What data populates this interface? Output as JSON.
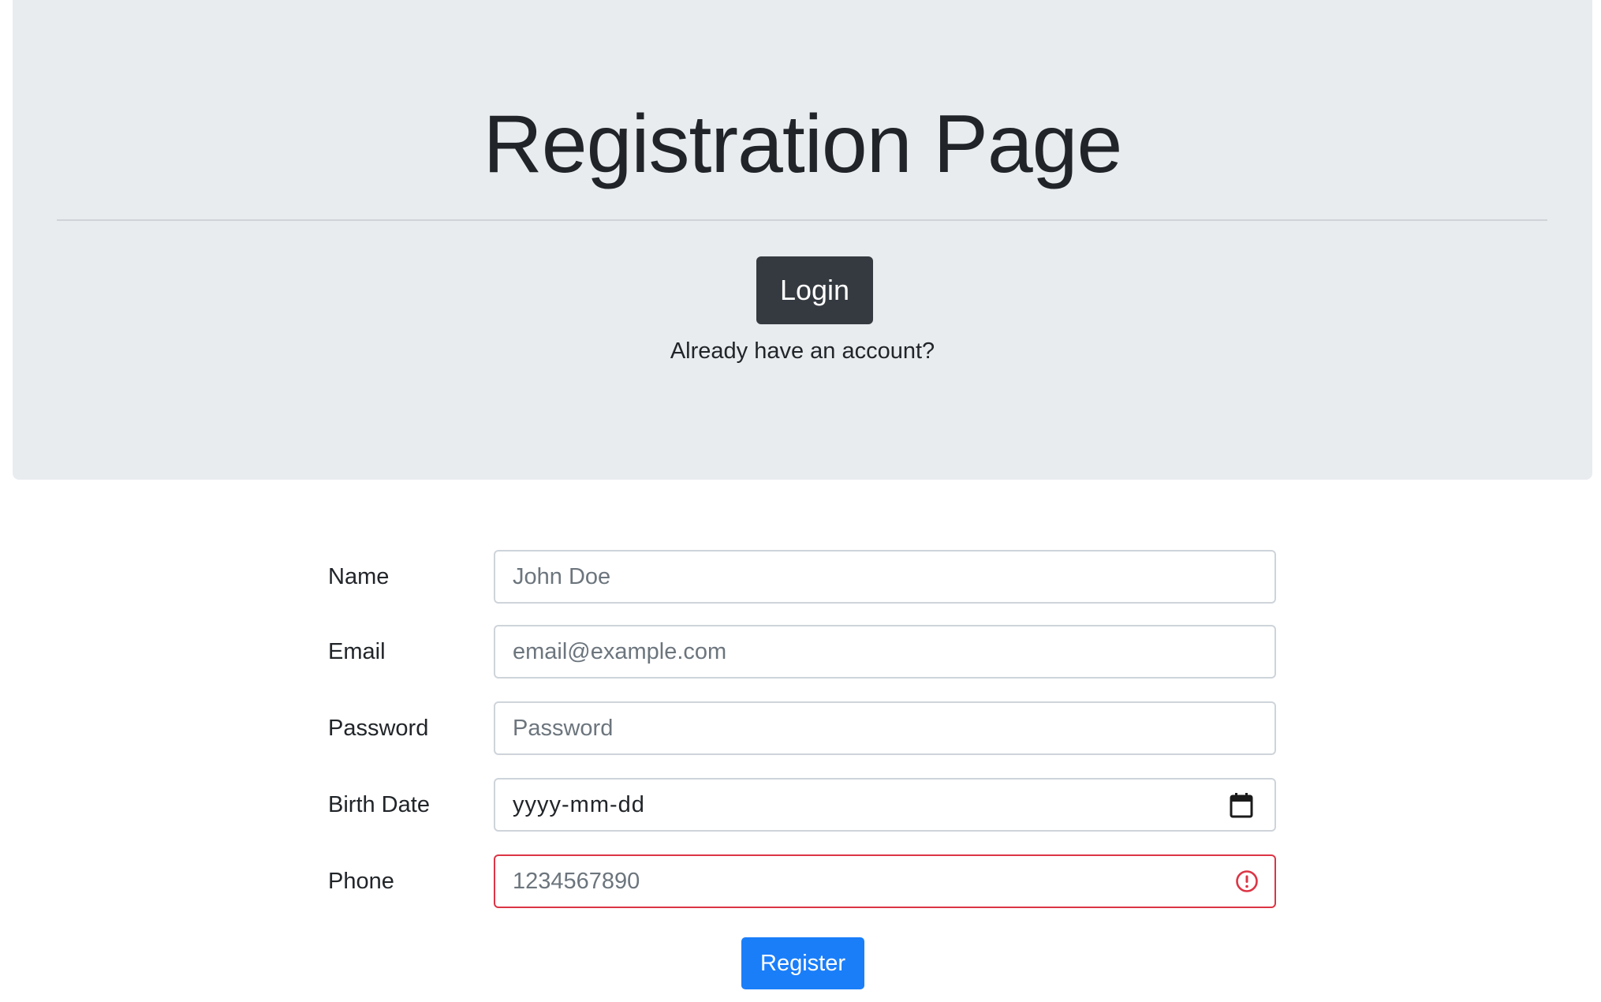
{
  "header": {
    "title": "Registration Page",
    "login_label": "Login",
    "login_hint": "Already have an account?"
  },
  "form": {
    "fields": [
      {
        "label": "Name",
        "placeholder": "John Doe",
        "value": ""
      },
      {
        "label": "Email",
        "placeholder": "email@example.com",
        "value": ""
      },
      {
        "label": "Password",
        "placeholder": "Password",
        "value": ""
      },
      {
        "label": "Birth Date",
        "placeholder": "yyyy-mm-dd",
        "value": "",
        "icon": "calendar-icon"
      },
      {
        "label": "Phone",
        "placeholder": "1234567890",
        "value": "",
        "state": "invalid",
        "icon": "invalid-icon"
      }
    ],
    "submit_label": "Register"
  },
  "colors": {
    "jumbotron_bg": "#e9ecef",
    "login_button": "#343a40",
    "register_button": "#1a7ef9",
    "invalid_border": "#dc3545"
  }
}
